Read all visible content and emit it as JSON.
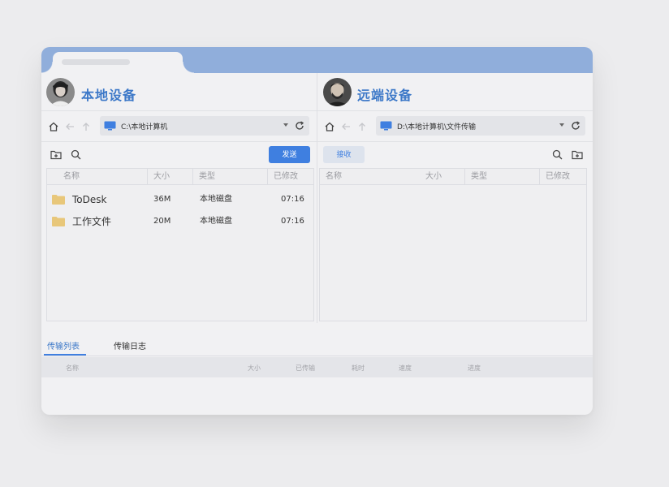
{
  "left_pane": {
    "title": "本地设备",
    "path": "C:\\本地计算机",
    "send_label": "发送",
    "columns": [
      "名称",
      "大小",
      "类型",
      "已修改"
    ],
    "rows": [
      {
        "name": "ToDesk",
        "size": "36M",
        "type": "本地磁盘",
        "modified": "07:16"
      },
      {
        "name": "工作文件",
        "size": "20M",
        "type": "本地磁盘",
        "modified": "07:16"
      }
    ]
  },
  "right_pane": {
    "title": "远端设备",
    "path": "D:\\本地计算机\\文件传输",
    "receive_label": "接收",
    "columns": [
      "名称",
      "大小",
      "类型",
      "已修改"
    ]
  },
  "bottom": {
    "tabs": [
      "传输列表",
      "传输日志"
    ],
    "columns": [
      "名称",
      "大小",
      "已传输",
      "耗时",
      "速度",
      "进度"
    ]
  },
  "colors": {
    "accent": "#3f7fe0",
    "title_blue": "#3c78c8",
    "titlebar": "#90aedb",
    "folder": "#e8c77a"
  }
}
